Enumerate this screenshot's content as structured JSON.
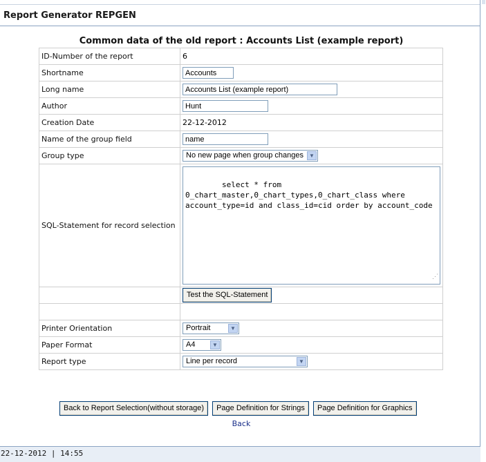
{
  "app": {
    "title": "Report Generator REPGEN"
  },
  "heading": "Common data of the old report : Accounts List (example report)",
  "fields": {
    "id": {
      "label": "ID-Number of the report",
      "value": "6"
    },
    "shortname": {
      "label": "Shortname",
      "value": "Accounts"
    },
    "longname": {
      "label": "Long name",
      "value": "Accounts List (example report)"
    },
    "author": {
      "label": "Author",
      "value": "Hunt"
    },
    "creation_date": {
      "label": "Creation Date",
      "value": "22-12-2012"
    },
    "group_field": {
      "label": "Name of the group field",
      "value": "name"
    },
    "group_type": {
      "label": "Group type",
      "value": "No new page when group changes"
    },
    "sql": {
      "label": "SQL-Statement for record selection",
      "value": "select * from 0_chart_master,0_chart_types,0_chart_class where account_type=id and class_id=cid order by account_code"
    },
    "test_sql_label": "Test the SQL-Statement",
    "orientation": {
      "label": "Printer Orientation",
      "value": "Portrait"
    },
    "paper": {
      "label": "Paper Format",
      "value": "A4"
    },
    "report_type": {
      "label": "Report type",
      "value": "Line per record"
    }
  },
  "buttons": {
    "back_selection": "Back to Report Selection(without storage)",
    "page_strings": "Page Definition for Strings",
    "page_graphics": "Page Definition for Graphics"
  },
  "back_link": "Back",
  "status": {
    "datetime": "22-12-2012 | 14:55"
  }
}
